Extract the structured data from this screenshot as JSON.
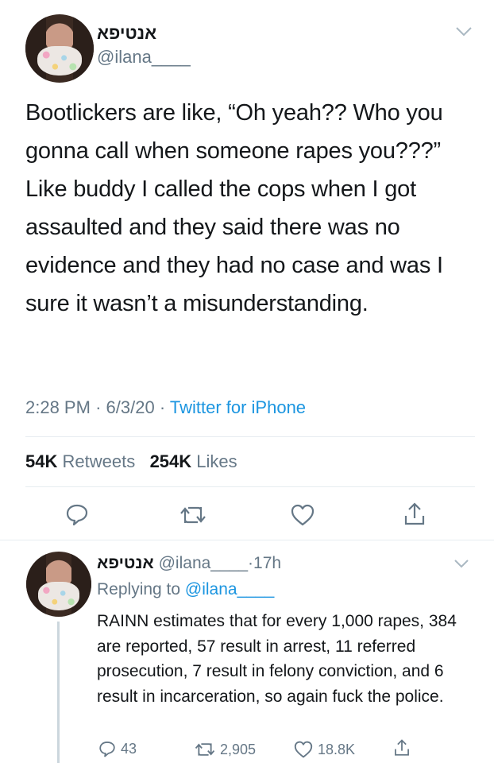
{
  "tweet": {
    "display_name": "אנטיפא",
    "handle": "@ilana____",
    "text": "Bootlickers are like, “Oh yeah?? Who you gonna call when someone rapes you???” Like buddy I called the cops when I got assaulted and they said there was no evidence and they had no case and was I sure it wasn’t a misunderstanding.",
    "time": "2:28 PM",
    "date": "6/3/20",
    "sep": "·",
    "source": "Twitter for iPhone",
    "retweets_count": "54K",
    "retweets_label": "Retweets",
    "likes_count": "254K",
    "likes_label": "Likes"
  },
  "actions": [
    "reply-icon",
    "retweet-icon",
    "like-icon",
    "share-icon"
  ],
  "reply": {
    "display_name": "אנטיפא",
    "handle": "@ilana____",
    "age": "·17h",
    "replying_label": "Replying to",
    "replying_handle": "@ilana____",
    "text": "RAINN estimates that for every 1,000 rapes, 384 are reported, 57 result in arrest, 11 referred prosecution, 7 result in felony conviction, and 6 result in incarceration, so again fuck the police.",
    "reply_count": "43",
    "retweet_count": "2,905",
    "like_count": "18.8K"
  },
  "colors": {
    "link": "#1b95e0",
    "muted": "#657786",
    "text": "#14171a",
    "divider": "#e6ecf0"
  }
}
